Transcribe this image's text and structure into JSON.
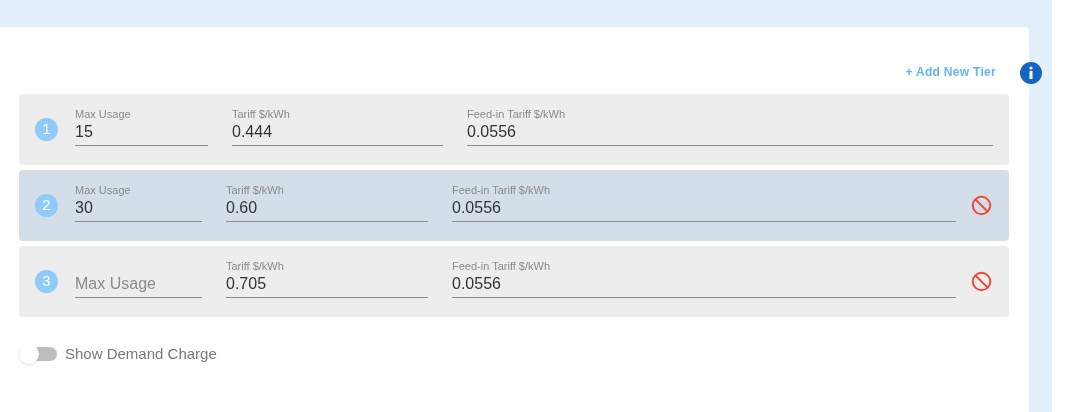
{
  "add_tier_link": "+ Add New Tier",
  "tiers": [
    {
      "number": "1",
      "selected": false,
      "deletable": false,
      "fields": [
        {
          "label": "Max Usage",
          "value": "15"
        },
        {
          "label": "Tariff $/kWh",
          "value": "0.444"
        },
        {
          "label": "Feed-in Tariff $/kWh",
          "value": "0.0556"
        }
      ]
    },
    {
      "number": "2",
      "selected": true,
      "deletable": true,
      "fields": [
        {
          "label": "Max Usage",
          "value": "30"
        },
        {
          "label": "Tariff $/kWh",
          "value": "0.60"
        },
        {
          "label": "Feed-in Tariff $/kWh",
          "value": "0.0556"
        }
      ]
    },
    {
      "number": "3",
      "selected": false,
      "deletable": true,
      "fields": [
        {
          "placeholder": "Max Usage"
        },
        {
          "label": "Tariff $/kWh",
          "value": "0.705"
        },
        {
          "label": "Feed-in Tariff $/kWh",
          "value": "0.0556"
        }
      ]
    }
  ],
  "demand_charge": {
    "label": "Show Demand Charge",
    "on": false
  }
}
